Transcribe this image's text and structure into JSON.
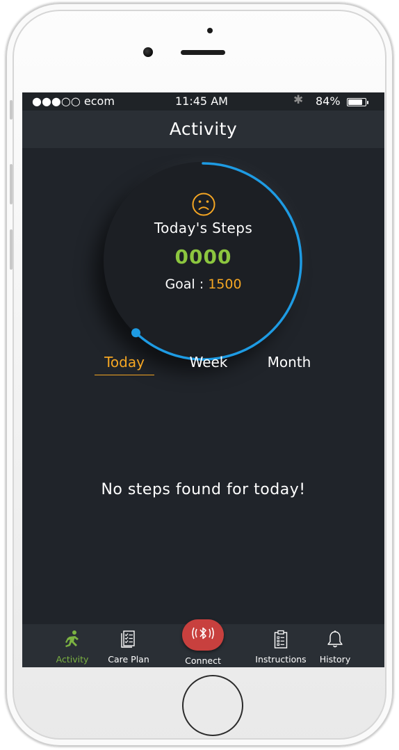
{
  "status_bar": {
    "carrier": "●●●○○ ecom",
    "time": "11:45 AM",
    "battery": "84%",
    "battery_level": 0.84
  },
  "header": {
    "title": "Activity"
  },
  "summary": {
    "mood": "sad-face-icon",
    "steps_label": "Today's Steps",
    "steps_value": "0000",
    "goal_label": "Goal :",
    "goal_value": "1500",
    "progress_fraction": 0.62
  },
  "period_tabs": [
    {
      "label": "Today",
      "selected": true
    },
    {
      "label": "Week",
      "selected": false
    },
    {
      "label": "Month",
      "selected": false
    }
  ],
  "empty_message": "No steps found for today!",
  "tab_bar": {
    "items": [
      {
        "label": "Activity",
        "icon": "runner-icon",
        "active": true
      },
      {
        "label": "Care Plan",
        "icon": "checklist-icon",
        "active": false
      },
      {
        "label": "Connect",
        "icon": "bluetooth-icon",
        "active": false
      },
      {
        "label": "Instructions",
        "icon": "clipboard-icon",
        "active": false
      },
      {
        "label": "History",
        "icon": "bell-icon",
        "active": false
      }
    ]
  },
  "colors": {
    "background": "#20242a",
    "bar": "#2a2f35",
    "accent_green": "#8cc63f",
    "accent_orange": "#f5a623",
    "ring_blue": "#1e9be3",
    "connect_red": "#c8403e"
  }
}
